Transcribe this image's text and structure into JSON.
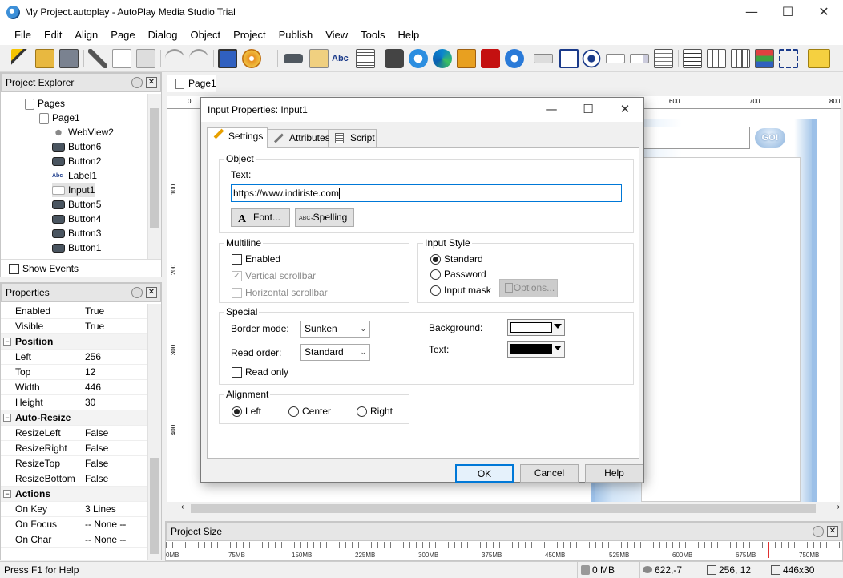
{
  "window": {
    "title": "My Project.autoplay - AutoPlay Media Studio Trial",
    "minimize": "—",
    "maximize": "☐",
    "close": "✕"
  },
  "menu": [
    "File",
    "Edit",
    "Align",
    "Page",
    "Dialog",
    "Object",
    "Project",
    "Publish",
    "View",
    "Tools",
    "Help"
  ],
  "project_explorer": {
    "title": "Project Explorer",
    "items": [
      {
        "label": "Pages",
        "type": "folder"
      },
      {
        "label": "Page1",
        "type": "page"
      },
      {
        "label": "WebView2",
        "type": "webview"
      },
      {
        "label": "Button6",
        "type": "button"
      },
      {
        "label": "Button2",
        "type": "button"
      },
      {
        "label": "Label1",
        "type": "label"
      },
      {
        "label": "Input1",
        "type": "input",
        "selected": true
      },
      {
        "label": "Button5",
        "type": "button"
      },
      {
        "label": "Button4",
        "type": "button"
      },
      {
        "label": "Button3",
        "type": "button"
      },
      {
        "label": "Button1",
        "type": "button"
      }
    ],
    "show_events": "Show Events"
  },
  "properties": {
    "title": "Properties",
    "rows": [
      {
        "k": "Enabled",
        "v": "True"
      },
      {
        "k": "Visible",
        "v": "True"
      },
      {
        "k": "Position",
        "v": "",
        "cat": true
      },
      {
        "k": "Left",
        "v": "256"
      },
      {
        "k": "Top",
        "v": "12"
      },
      {
        "k": "Width",
        "v": "446"
      },
      {
        "k": "Height",
        "v": "30"
      },
      {
        "k": "Auto-Resize",
        "v": "",
        "cat": true
      },
      {
        "k": "ResizeLeft",
        "v": "False"
      },
      {
        "k": "ResizeRight",
        "v": "False"
      },
      {
        "k": "ResizeTop",
        "v": "False"
      },
      {
        "k": "ResizeBottom",
        "v": "False"
      },
      {
        "k": "Actions",
        "v": "",
        "cat": true
      },
      {
        "k": "On Key",
        "v": "3 Lines"
      },
      {
        "k": "On Focus",
        "v": "-- None --"
      },
      {
        "k": "On Char",
        "v": "-- None --"
      }
    ]
  },
  "editor": {
    "page_tab": "Page1",
    "go_button": "GO!",
    "ruler_h": [
      "0",
      "600",
      "700",
      "800"
    ],
    "ruler_v": [
      "100",
      "200",
      "300",
      "400"
    ]
  },
  "project_size": {
    "title": "Project Size",
    "ticks": [
      "0MB",
      "75MB",
      "150MB",
      "225MB",
      "300MB",
      "375MB",
      "450MB",
      "525MB",
      "600MB",
      "675MB",
      "750MB"
    ]
  },
  "status": {
    "help": "Press F1 for Help",
    "size": "0 MB",
    "cursor": "622,-7",
    "pos": "256, 12",
    "dims": "446x30"
  },
  "dialog": {
    "title": "Input Properties: Input1",
    "tabs": [
      "Settings",
      "Attributes",
      "Script"
    ],
    "object_group": "Object",
    "text_label": "Text:",
    "text_value": "https://www.indiriste.com",
    "font_btn": "Font...",
    "spelling_btn": "Spelling",
    "multiline_group": "Multiline",
    "ml_enabled": "Enabled",
    "ml_vscroll": "Vertical scrollbar",
    "ml_hscroll": "Horizontal scrollbar",
    "inputstyle_group": "Input Style",
    "is_standard": "Standard",
    "is_password": "Password",
    "is_mask": "Input mask",
    "options_btn": "Options...",
    "special_group": "Special",
    "border_mode_label": "Border mode:",
    "border_mode_value": "Sunken",
    "read_order_label": "Read order:",
    "read_order_value": "Standard",
    "read_only": "Read only",
    "background_label": "Background:",
    "background_color": "#ffffff",
    "text_color_label": "Text:",
    "text_color": "#000000",
    "alignment_group": "Alignment",
    "al_left": "Left",
    "al_center": "Center",
    "al_right": "Right",
    "ok": "OK",
    "cancel": "Cancel",
    "help": "Help"
  }
}
